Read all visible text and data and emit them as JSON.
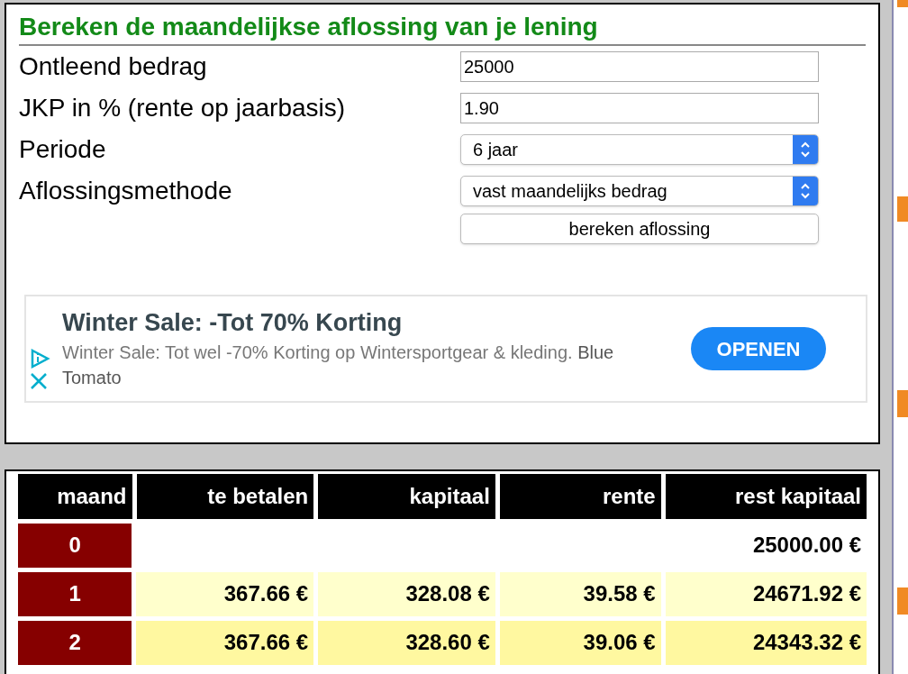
{
  "calculator": {
    "title": "Bereken de maandelijkse aflossing van je lening",
    "fields": [
      {
        "kind": "input",
        "label": "Ontleend bedrag",
        "value": "25000"
      },
      {
        "kind": "input",
        "label": "JKP in % (rente op jaarbasis)",
        "value": "1.90"
      },
      {
        "kind": "select",
        "label": "Periode",
        "value": "6 jaar"
      },
      {
        "kind": "select",
        "label": "Aflossingsmethode",
        "value": "vast maandelijks bedrag"
      }
    ],
    "button": "bereken aflossing"
  },
  "ad": {
    "title": "Winter Sale: -Tot 70% Korting",
    "text": "Winter Sale: Tot wel -70% Korting op Wintersportgear & kleding.",
    "advertiser": "Blue Tomato",
    "button": "OPENEN"
  },
  "table": {
    "columns": [
      "maand",
      "te betalen",
      "kapitaal",
      "rente",
      "rest kapitaal"
    ],
    "rows": [
      [
        "0",
        "",
        "",
        "",
        "25000.00 €"
      ],
      [
        "1",
        "367.66 €",
        "328.08 €",
        "39.58 €",
        "24671.92 €"
      ],
      [
        "2",
        "367.66 €",
        "328.60 €",
        "39.06 €",
        "24343.32 €"
      ]
    ]
  }
}
